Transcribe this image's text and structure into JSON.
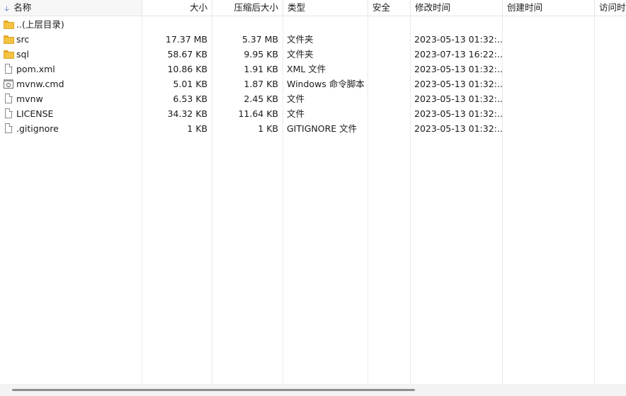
{
  "columns": {
    "name": "名称",
    "size": "大小",
    "packed": "压缩后大小",
    "type": "类型",
    "security": "安全",
    "modified": "修改时间",
    "created": "创建时间",
    "accessed": "访问时间"
  },
  "rows": [
    {
      "name": "..(上层目录)",
      "size": "",
      "packed": "",
      "type": "",
      "modified": "",
      "icon": "folder-icon"
    },
    {
      "name": "src",
      "size": "17.37 MB",
      "packed": "5.37 MB",
      "type": "文件夹",
      "modified": "2023-05-13 01:32:...",
      "icon": "folder-icon"
    },
    {
      "name": "sql",
      "size": "58.67 KB",
      "packed": "9.95 KB",
      "type": "文件夹",
      "modified": "2023-07-13 16:22:...",
      "icon": "folder-icon"
    },
    {
      "name": "pom.xml",
      "size": "10.86 KB",
      "packed": "1.91 KB",
      "type": "XML 文件",
      "modified": "2023-05-13 01:32:...",
      "icon": "file-icon"
    },
    {
      "name": "mvnw.cmd",
      "size": "5.01 KB",
      "packed": "1.87 KB",
      "type": "Windows 命令脚本",
      "modified": "2023-05-13 01:32:...",
      "icon": "cmd-script-icon"
    },
    {
      "name": "mvnw",
      "size": "6.53 KB",
      "packed": "2.45 KB",
      "type": "文件",
      "modified": "2023-05-13 01:32:...",
      "icon": "file-icon"
    },
    {
      "name": "LICENSE",
      "size": "34.32 KB",
      "packed": "11.64 KB",
      "type": "文件",
      "modified": "2023-05-13 01:32:...",
      "icon": "file-icon"
    },
    {
      "name": ".gitignore",
      "size": "1 KB",
      "packed": "1 KB",
      "type": "GITIGNORE 文件",
      "modified": "2023-05-13 01:32:...",
      "icon": "file-icon"
    }
  ],
  "colors": {
    "sort_arrow": "#3b6fb6",
    "folder": "#f5c242"
  }
}
